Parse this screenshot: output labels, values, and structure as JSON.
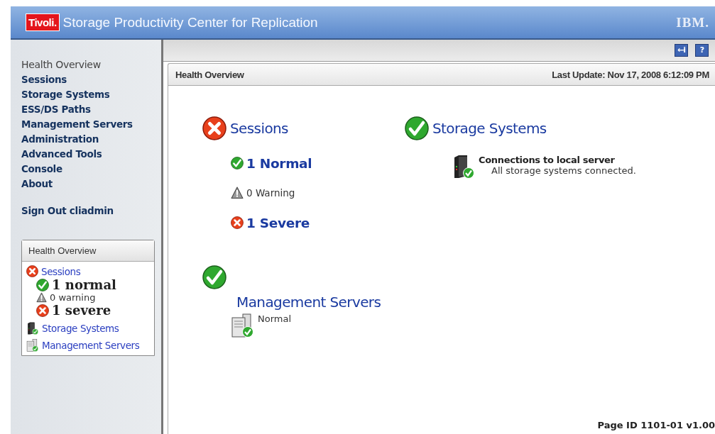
{
  "header": {
    "brand": "Tivoli.",
    "title": "Storage Productivity Center for Replication",
    "vendor": "IBM."
  },
  "nav": {
    "items": [
      {
        "label": "Health Overview",
        "selected": true
      },
      {
        "label": "Sessions",
        "selected": false
      },
      {
        "label": "Storage Systems",
        "selected": false
      },
      {
        "label": "ESS/DS Paths",
        "selected": false
      },
      {
        "label": "Management Servers",
        "selected": false
      },
      {
        "label": "Administration",
        "selected": false
      },
      {
        "label": "Advanced Tools",
        "selected": false
      },
      {
        "label": "Console",
        "selected": false
      },
      {
        "label": "About",
        "selected": false
      }
    ],
    "sign_out": "Sign Out cliadmin"
  },
  "mini_health": {
    "title": "Health Overview",
    "sessions": {
      "label": "Sessions",
      "kind": "severe"
    },
    "counts": [
      {
        "kind": "normal",
        "text": "1 normal",
        "emphasis": true
      },
      {
        "kind": "warning",
        "text": "0 warning",
        "emphasis": false
      },
      {
        "kind": "severe",
        "text": "1 severe",
        "emphasis": true
      }
    ],
    "links": [
      {
        "label": "Storage Systems",
        "kind": "storage"
      },
      {
        "label": "Management Servers",
        "kind": "servers"
      }
    ]
  },
  "toolbar": [
    {
      "glyph": "←i"
    },
    {
      "glyph": "?"
    }
  ],
  "panel": {
    "title": "Health Overview",
    "last_update": "Last Update: Nov 17, 2008 6:12:09 PM",
    "sessions": {
      "title": "Sessions",
      "kind": "severe",
      "counts": [
        {
          "kind": "normal",
          "text": "1 Normal",
          "emphasis": true
        },
        {
          "kind": "warning",
          "text": "0 Warning",
          "emphasis": false
        },
        {
          "kind": "severe",
          "text": "1 Severe",
          "emphasis": true
        }
      ]
    },
    "storage": {
      "title": "Storage Systems",
      "kind": "normal",
      "detail_title": "Connections to local server",
      "detail_text": "All storage systems connected."
    },
    "servers": {
      "title": "Management Servers",
      "kind": "normal",
      "detail_text": "Normal"
    },
    "footer": "Page ID 1101-01 v1.00"
  }
}
